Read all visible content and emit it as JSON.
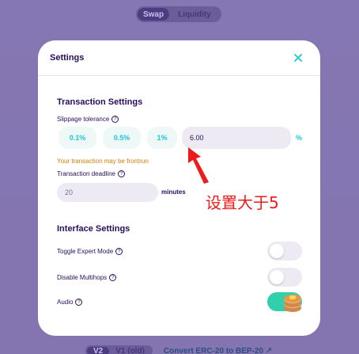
{
  "background": {
    "tabs": {
      "swap": "Swap",
      "liquidity": "Liquidity"
    },
    "version_tabs": {
      "v2": "V2",
      "v1": "V1 (old)"
    },
    "convert_link": "Convert ERC-20 to BEP-20 ↗"
  },
  "modal": {
    "title": "Settings",
    "close_icon": "close-icon",
    "transaction": {
      "title": "Transaction Settings",
      "slippage_label": "Slippage tolerance",
      "options": [
        "0.1%",
        "0.5%",
        "1%"
      ],
      "slippage_value": "6.00",
      "percent_symbol": "%",
      "warning": "Your transaction may be frontrun",
      "deadline_label": "Transaction deadline",
      "deadline_value": "20",
      "minutes_label": "minutes"
    },
    "interface": {
      "title": "Interface Settings",
      "expert_mode": {
        "label": "Toggle Expert Mode",
        "enabled": false
      },
      "multihops": {
        "label": "Disable Multihops",
        "enabled": false
      },
      "audio": {
        "label": "Audio",
        "enabled": true
      }
    }
  },
  "annotation": {
    "text": "设置大于5"
  },
  "colors": {
    "accent": "#1fc7d4",
    "text": "#280d5f",
    "warning": "#d67e0a",
    "toggle_on": "#31d0aa",
    "annotation": "#ee1b1b"
  }
}
